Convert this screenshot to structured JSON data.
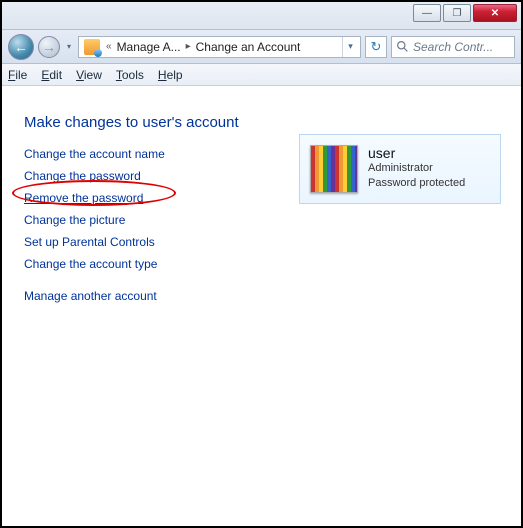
{
  "titlebar": {
    "minimize": "—",
    "maximize": "❐",
    "close": "✕"
  },
  "nav": {
    "back": "←",
    "forward": "→",
    "dropdown": "▾",
    "breadcrumb_prefix": "«",
    "segment1": "Manage A...",
    "segment2": "Change an Account",
    "sep": "▸",
    "addr_dd": "▾",
    "refresh": "↻"
  },
  "search": {
    "placeholder": "Search Contr..."
  },
  "menu": {
    "file": "File",
    "edit": "Edit",
    "view": "View",
    "tools": "Tools",
    "help": "Help"
  },
  "heading": "Make changes to user's account",
  "links": {
    "change_name": "Change the account name",
    "change_pw": "Change the password",
    "remove_pw": "Remove the password",
    "change_pic": "Change the picture",
    "parental": "Set up Parental Controls",
    "change_type": "Change the account type",
    "manage_other": "Manage another account"
  },
  "account": {
    "name": "user",
    "role": "Administrator",
    "protection": "Password protected"
  }
}
